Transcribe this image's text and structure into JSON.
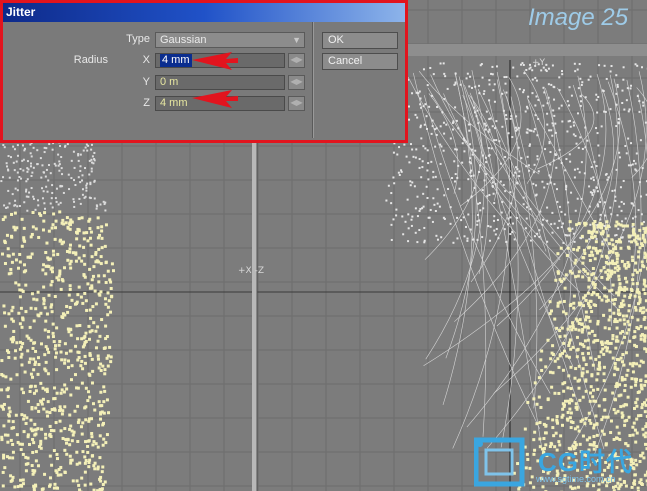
{
  "caption": "Image 25",
  "viewport": {
    "axis_label_center": "+X -Z",
    "axis_label_top": "+Y"
  },
  "dialog": {
    "title": "Jitter",
    "type_label": "Type",
    "type_value": "Gaussian",
    "radius_label": "Radius",
    "x_label": "X",
    "x_value": "4 mm",
    "y_label": "Y",
    "y_value": "0 m",
    "z_label": "Z",
    "z_value": "4 mm",
    "ok_label": "OK",
    "cancel_label": "Cancel"
  },
  "logo": {
    "text": "CG时代",
    "url": "www.sgtime.com.cn"
  },
  "colors": {
    "highlight_border": "#e2141e",
    "title_bar": "#0e2a8a",
    "point_color": "#f4f0b8",
    "caption_color": "#9ecbe8"
  }
}
